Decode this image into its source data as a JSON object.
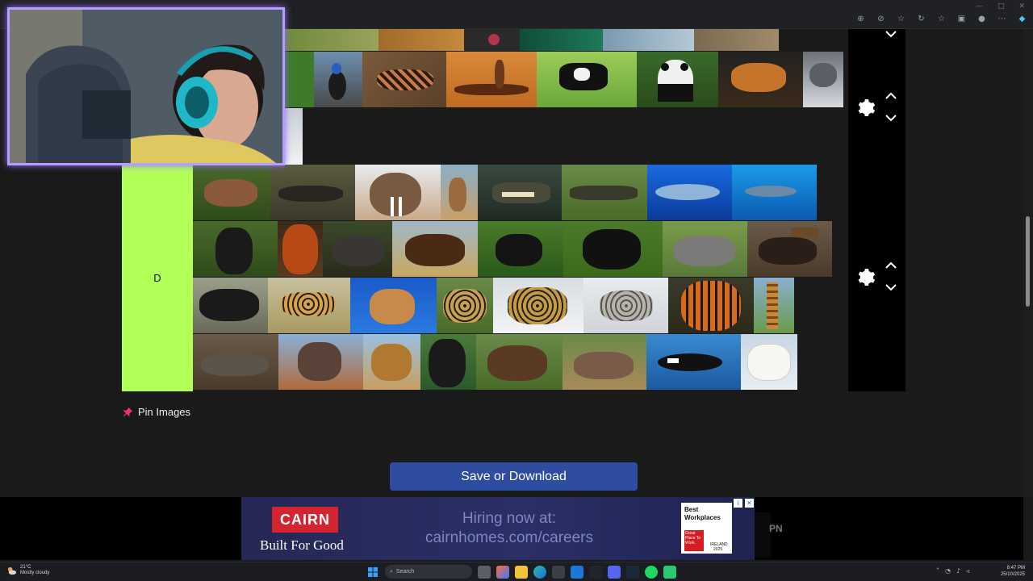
{
  "browser": {
    "toolbar_icons": [
      "zoom-icon",
      "block-icon",
      "star-icon",
      "refresh-icon",
      "favorites-icon",
      "collections-icon",
      "profile-icon",
      "more-icon",
      "copilot-icon"
    ]
  },
  "tierlist": {
    "rows": [
      {
        "label": "",
        "id": "upper"
      },
      {
        "label": "D",
        "id": "d"
      }
    ]
  },
  "actions": {
    "pin_label": "Pin Images",
    "save_label": "Save or Download"
  },
  "ad": {
    "brand": "CAIRN",
    "tagline": "Built For Good",
    "hiring": "Hiring now at:",
    "url": "cairnhomes.com/careers",
    "badge_title": "Best Workplaces",
    "badge_red": "Great Place To Work.",
    "badge_country": "IRELAND",
    "badge_year": "2025",
    "side_text": "PN"
  },
  "taskbar": {
    "temp": "21°C",
    "weather": "Mostly cloudy",
    "search_placeholder": "Search",
    "time": "8:47 PM",
    "date": "25/10/2025"
  },
  "colors": {
    "tier_d": "#b1ff57",
    "save_button": "#2e4da0",
    "cam_border": "#b79dff"
  }
}
